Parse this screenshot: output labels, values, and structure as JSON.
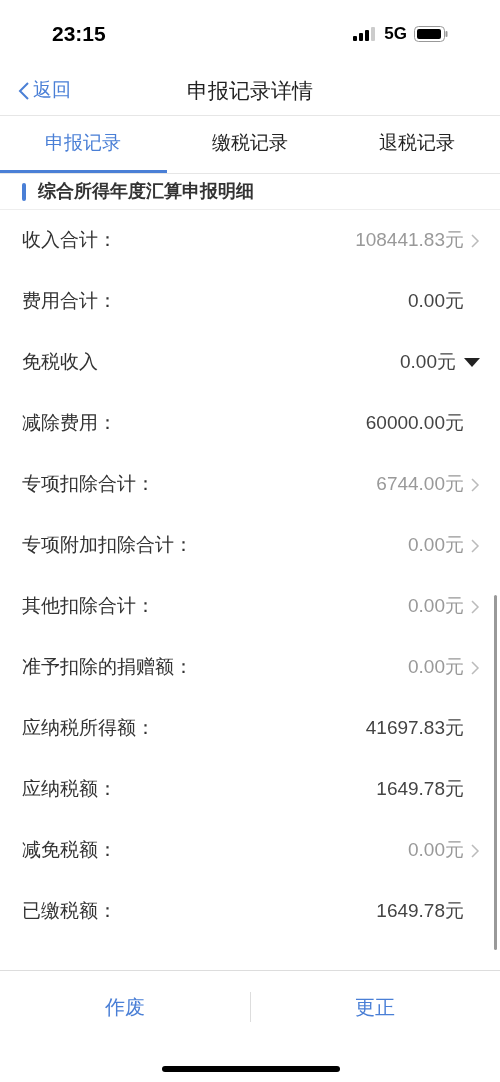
{
  "status_bar": {
    "time": "23:15",
    "network": "5G"
  },
  "nav": {
    "back": "返回",
    "title": "申报记录详情"
  },
  "tabs": [
    {
      "label": "申报记录",
      "selected": true
    },
    {
      "label": "缴税记录",
      "selected": false
    },
    {
      "label": "退税记录",
      "selected": false
    }
  ],
  "section_title": "综合所得年度汇算申报明细",
  "rows": [
    {
      "label": "收入合计：",
      "value": "108441.83元",
      "kind": "link"
    },
    {
      "label": "费用合计：",
      "value": "0.00元",
      "kind": "plain"
    },
    {
      "label": "免税收入",
      "value": "0.00元",
      "kind": "dropdown"
    },
    {
      "label": "减除费用：",
      "value": "60000.00元",
      "kind": "plain"
    },
    {
      "label": "专项扣除合计：",
      "value": "6744.00元",
      "kind": "link"
    },
    {
      "label": "专项附加扣除合计：",
      "value": "0.00元",
      "kind": "link"
    },
    {
      "label": "其他扣除合计：",
      "value": "0.00元",
      "kind": "link"
    },
    {
      "label": "准予扣除的捐赠额：",
      "value": "0.00元",
      "kind": "link"
    },
    {
      "label": "应纳税所得额：",
      "value": "41697.83元",
      "kind": "plain"
    },
    {
      "label": "应纳税额：",
      "value": "1649.78元",
      "kind": "plain"
    },
    {
      "label": "减免税额：",
      "value": "0.00元",
      "kind": "link"
    },
    {
      "label": "已缴税额：",
      "value": "1649.78元",
      "kind": "plain"
    }
  ],
  "actions": [
    "作废",
    "更正"
  ]
}
